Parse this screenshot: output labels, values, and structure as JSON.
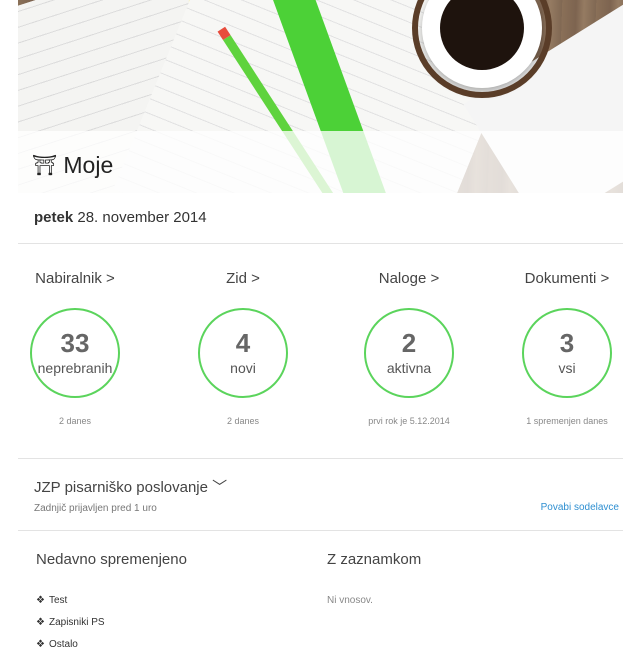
{
  "header": {
    "title": "Moje",
    "icon": "home-icon"
  },
  "date": {
    "weekday": "petek",
    "rest": "28. november 2014"
  },
  "stats": [
    {
      "label": "Nabiralnik",
      "chevron": ">",
      "value": "33",
      "unit": "neprebranih",
      "sub": "2 danes"
    },
    {
      "label": "Zid",
      "chevron": ">",
      "value": "4",
      "unit": "novi",
      "sub": "2 danes"
    },
    {
      "label": "Naloge",
      "chevron": ">",
      "value": "2",
      "unit": "aktivna",
      "sub": "prvi rok je 5.12.2014"
    },
    {
      "label": "Dokumenti",
      "chevron": ">",
      "value": "3",
      "unit": "vsi",
      "sub": "1 spremenjen danes"
    }
  ],
  "project": {
    "name": "JZP pisarniško poslovanje",
    "last_login": "Zadnjič prijavljen pred 1 uro",
    "invite": "Povabi sodelavce"
  },
  "recent": {
    "title": "Nedavno spremenjeno",
    "items": [
      "Test",
      "Zapisniki PS",
      "Ostalo"
    ]
  },
  "bookmarks": {
    "title": "Z zaznamkom",
    "empty": "Ni vnosov."
  },
  "colors": {
    "accent": "#5bd45c",
    "link": "#2e8fd1"
  }
}
